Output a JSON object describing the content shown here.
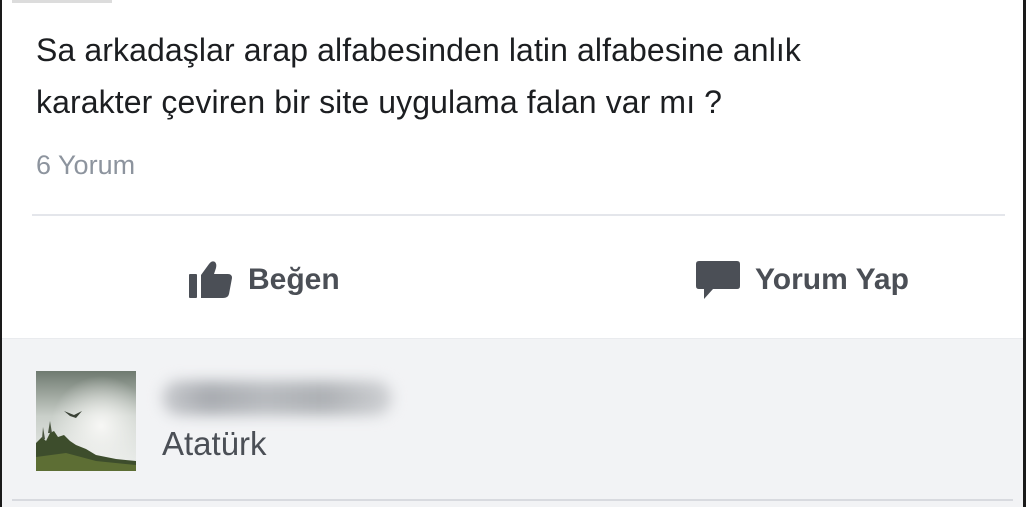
{
  "post": {
    "text_line1": "Sa arkadaşlar arap alfabesinden latin alfabesine anlık",
    "text_line2": "karakter çeviren bir site uygulama falan var mı ?",
    "comment_count": "6 Yorum"
  },
  "actions": {
    "like": {
      "label": "Beğen",
      "icon": "thumbs-up-icon"
    },
    "comment": {
      "label": "Yorum Yap",
      "icon": "speech-bubble-icon"
    }
  },
  "comment": {
    "author_blurred": true,
    "text": "Atatürk"
  },
  "colors": {
    "text_primary": "#1c1e21",
    "text_secondary": "#8d949e",
    "action_text": "#4b4f56",
    "comment_background": "#f2f3f5"
  }
}
